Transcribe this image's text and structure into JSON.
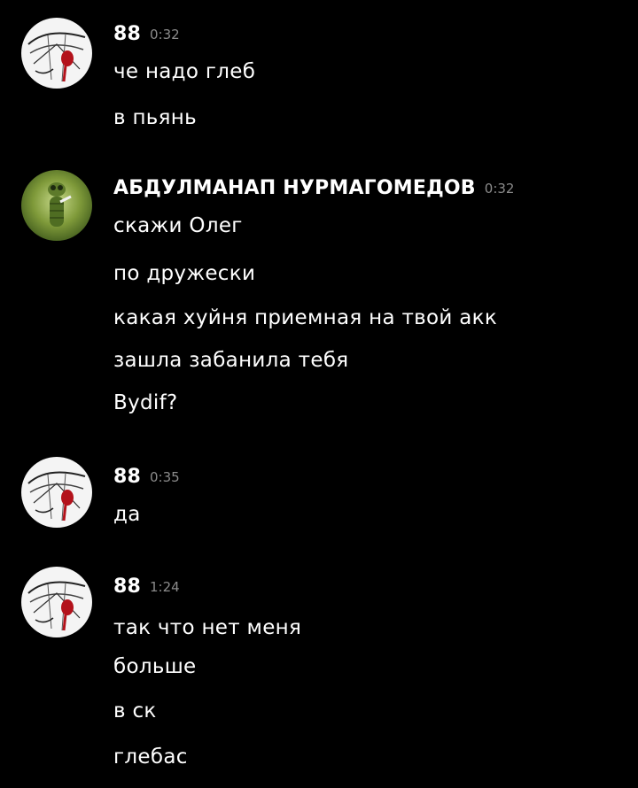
{
  "colors": {
    "background": "#000000",
    "text": "#ffffff",
    "timestamp": "#8b8b8b"
  },
  "messages": [
    {
      "author": "88",
      "time": "0:32",
      "avatar_icon": "sketch-face-avatar-icon",
      "lines": [
        "че надо глеб",
        "в пьянь"
      ]
    },
    {
      "author": "АБДУЛМАНАП НУРМАГОМЕДОВ",
      "time": "0:32",
      "avatar_icon": "green-figure-avatar-icon",
      "lines": [
        "скажи Олег",
        "по дружески",
        "какая хуйня приемная на твой акк",
        "зашла забанила тебя",
        "Bydif?"
      ]
    },
    {
      "author": "88",
      "time": "0:35",
      "avatar_icon": "sketch-face-avatar-icon",
      "lines": [
        "да"
      ]
    },
    {
      "author": "88",
      "time": "1:24",
      "avatar_icon": "sketch-face-avatar-icon",
      "lines": [
        "так что нет меня",
        "больше",
        "в ск",
        "глебас"
      ]
    }
  ]
}
